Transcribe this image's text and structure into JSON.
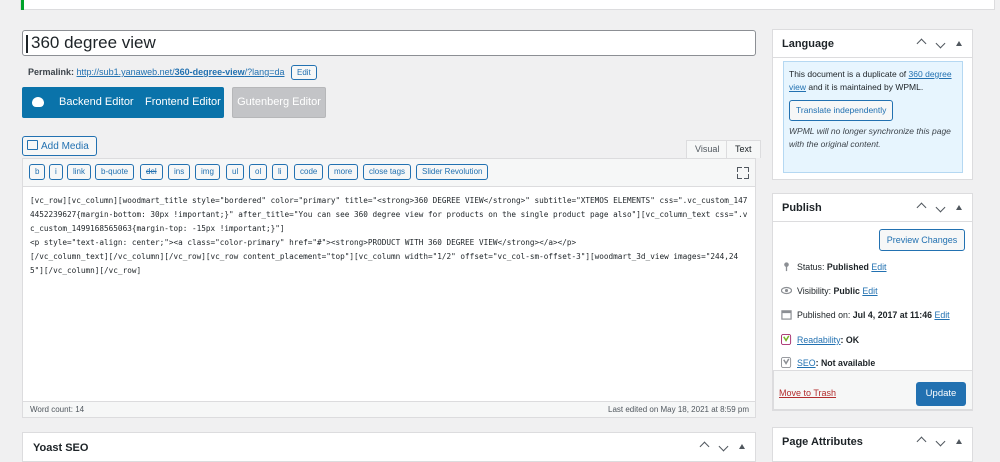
{
  "post": {
    "title": "360 degree view",
    "permalink_label": "Permalink:",
    "permalink_url_prefix": "http://sub1.yanaweb.net/",
    "permalink_slug": "360-degree-view",
    "permalink_url_suffix": "/?lang=da",
    "permalink_edit": "Edit"
  },
  "builder": {
    "backend_label": "Backend Editor",
    "frontend_label": "Frontend Editor",
    "gutenberg_label": "Gutenberg Editor"
  },
  "editor": {
    "add_media": "Add Media",
    "tab_visual": "Visual",
    "tab_text": "Text",
    "quicktags": [
      "b",
      "i",
      "link",
      "b-quote",
      "del",
      "ins",
      "img",
      "ul",
      "ol",
      "li",
      "code",
      "more",
      "close tags",
      "Slider Revolution"
    ],
    "content": "[vc_row][vc_column][woodmart_title style=\"bordered\" color=\"primary\" title=\"<strong>360 DEGREE VIEW</strong>\" subtitle=\"XTEMOS ELEMENTS\" css=\".vc_custom_1474452239627{margin-bottom: 30px !important;}\" after_title=\"You can see 360 degree view for products on the single product page also\"][vc_column_text css=\".vc_custom_1499168565063{margin-top: -15px !important;}\"]\n<p style=\"text-align: center;\"><a class=\"color-primary\" href=\"#\"><strong>PRODUCT WITH 360 DEGREE VIEW</strong></a></p>\n[/vc_column_text][/vc_column][/vc_row][vc_row content_placement=\"top\"][vc_column width=\"1/2\" offset=\"vc_col-sm-offset-3\"][woodmart_3d_view images=\"244,245\"][/vc_column][/vc_row]",
    "word_count": "Word count: 14",
    "last_edited": "Last edited on May 18, 2021 at 8:59 pm"
  },
  "yoast": {
    "title": "Yoast SEO"
  },
  "language_box": {
    "title": "Language",
    "notice_prefix": "This document is a duplicate of ",
    "notice_link": "360 degree view",
    "notice_suffix": " and it is maintained by WPML.",
    "translate_button": "Translate independently",
    "notice_note": "WPML will no longer synchronize this page with the original content."
  },
  "publish_box": {
    "title": "Publish",
    "preview_button": "Preview Changes",
    "status_label": "Status:",
    "status_value": "Published",
    "visibility_label": "Visibility:",
    "visibility_value": "Public",
    "published_label": "Published on:",
    "published_value": "Jul 4, 2017 at 11:46",
    "edit": "Edit",
    "readability_link": "Readability",
    "readability_value": ": OK",
    "seo_link": "SEO",
    "seo_value": ": Not available",
    "trash": "Move to Trash",
    "update": "Update"
  },
  "page_attributes": {
    "title": "Page Attributes"
  },
  "colors": {
    "accent": "#2271b1",
    "builder": "#0a73aa",
    "danger": "#b32d2e",
    "notice_bg": "#e7f5fe"
  }
}
